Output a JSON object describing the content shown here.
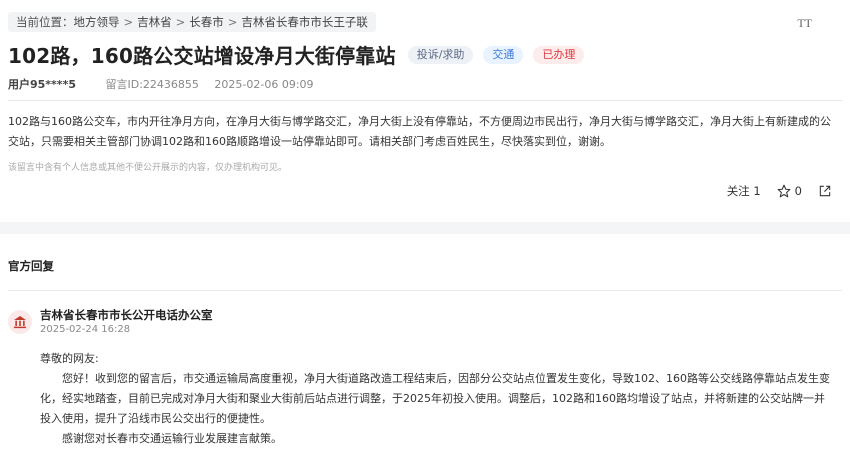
{
  "breadcrumb": {
    "prefix": "当前位置：",
    "items": [
      "地方领导",
      "吉林省",
      "长春市",
      "吉林省长春市市长王子联"
    ],
    "separator": ">"
  },
  "font_size_toggle": "TT",
  "post": {
    "title": "102路，160路公交站增设净月大街停靠站",
    "tags": {
      "type": "投诉/求助",
      "category": "交通",
      "status": "已办理"
    },
    "user": "用户95****5",
    "message_id": "留言ID:22436855",
    "datetime": "2025-02-06 09:09",
    "content": "102路与160路公交车，市内开往净月方向，在净月大街与博学路交汇，净月大街上没有停靠站，不方便周边市民出行，净月大街与博学路交汇，净月大街上有新建成的公交站，只需要相关主管部门协调102路和160路顺路增设一站停靠站即可。请相关部门考虑百姓民生，尽快落实到位，谢谢。",
    "privacy_notice": "该留言中含有个人信息或其他不便公开展示的内容，仅办理机构可见。"
  },
  "actions": {
    "follow_label": "关注",
    "follow_count": "1",
    "like_count": "0"
  },
  "reply": {
    "heading": "官方回复",
    "org_name": "吉林省长春市市长公开电话办公室",
    "date": "2025-02-24 16:28",
    "greeting": "尊敬的网友:",
    "paragraph1": "您好！收到您的留言后，市交通运输局高度重视，净月大街道路改造工程结束后，因部分公交站点位置发生变化，导致102、160路等公交线路停靠站点发生变化，经实地踏查，目前已完成对净月大街和聚业大街前后站点进行调整，于2025年初投入使用。调整后，102路和160路均增设了站点，并将新建的公交站牌一并投入使用，提升了沿线市民公交出行的便捷性。",
    "paragraph2": "感谢您对长春市交通运输行业发展建言献策。"
  },
  "colors": {
    "status_red": "#e0383e",
    "category_blue": "#3a7bd5",
    "seal_red": "#c0392b"
  }
}
